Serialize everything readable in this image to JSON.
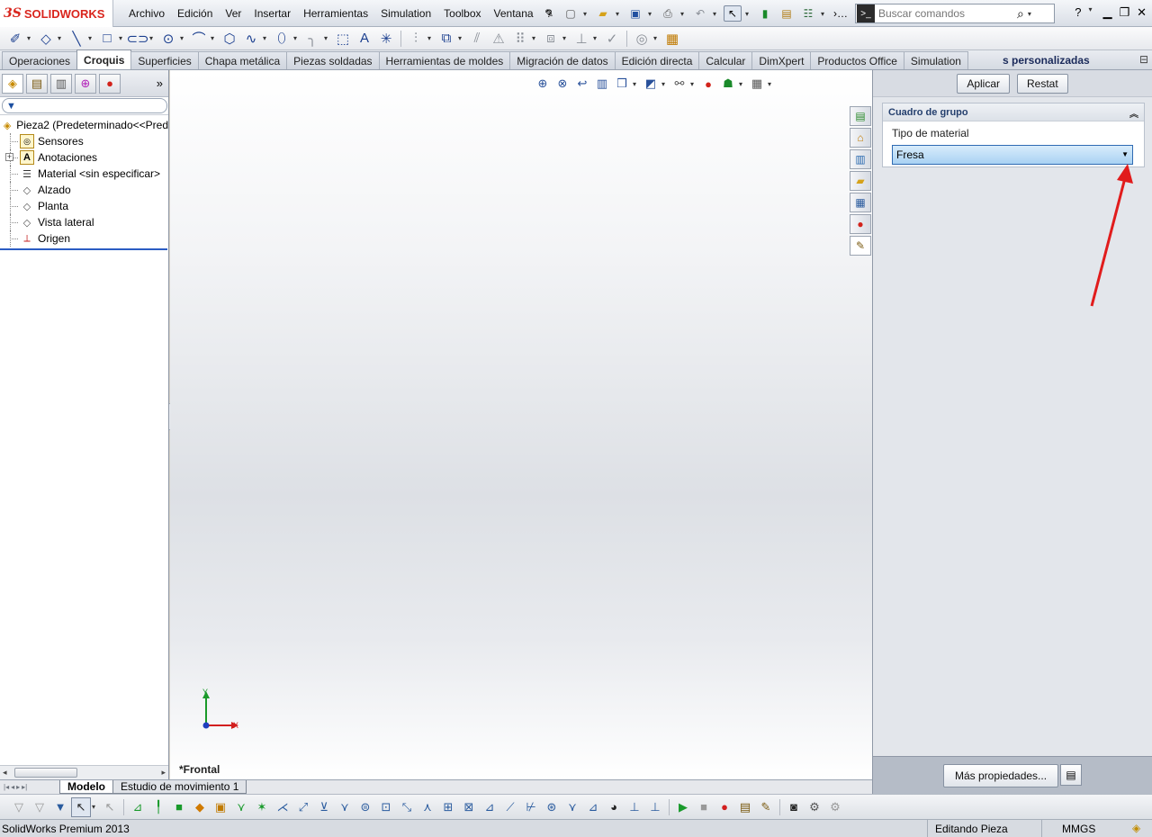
{
  "app": {
    "logo_ds": "3S",
    "logo_brand": "SOLIDWORKS"
  },
  "menu": {
    "items": [
      "Archivo",
      "Edición",
      "Ver",
      "Insertar",
      "Herramientas",
      "Simulation",
      "Toolbox",
      "Ventana",
      "?"
    ]
  },
  "search": {
    "placeholder": "Buscar comandos",
    "help_label": "?"
  },
  "tabs": {
    "items": [
      "Operaciones",
      "Croquis",
      "Superficies",
      "Chapa metálica",
      "Piezas soldadas",
      "Herramientas de moldes",
      "Migración de datos",
      "Edición directa",
      "Calcular",
      "DimXpert",
      "Productos Office",
      "Simulation"
    ],
    "active_index": 1,
    "extra_label": "s personalizadas"
  },
  "feature_tree": {
    "root": "Pieza2  (Predeterminado<<Pred",
    "items": [
      {
        "label": "Sensores",
        "icon": "sensor-icon",
        "expandable": false
      },
      {
        "label": "Anotaciones",
        "icon": "annotation-icon",
        "expandable": true
      },
      {
        "label": "Material <sin especificar>",
        "icon": "material-icon",
        "expandable": false
      },
      {
        "label": "Alzado",
        "icon": "plane-icon",
        "expandable": false
      },
      {
        "label": "Planta",
        "icon": "plane-icon",
        "expandable": false
      },
      {
        "label": "Vista lateral",
        "icon": "plane-icon",
        "expandable": false
      },
      {
        "label": "Origen",
        "icon": "origin-icon",
        "expandable": false
      }
    ]
  },
  "graphics": {
    "view_label": "*Frontal",
    "triad_x": "X",
    "triad_y": "Y"
  },
  "taskpane": {
    "apply_label": "Aplicar",
    "reset_label": "Restat",
    "group_title": "Cuadro de grupo",
    "field_label": "Tipo de material",
    "field_value": "Fresa",
    "more_properties_label": "Más propiedades..."
  },
  "model_tabs": {
    "items": [
      "Modelo",
      "Estudio de movimiento 1"
    ],
    "active_index": 0
  },
  "status": {
    "product": "SolidWorks Premium 2013",
    "mode": "Editando Pieza",
    "units": "MMGS"
  },
  "colors": {
    "brand_red": "#d9251d",
    "select_blue": "#a9d2f3",
    "annotation_arrow": "#e11c1c",
    "tree_separator": "#2b5cc3"
  }
}
